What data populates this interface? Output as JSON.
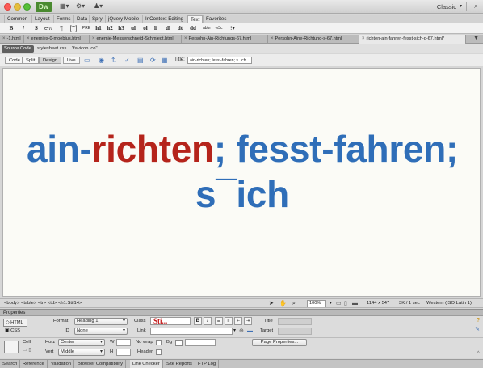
{
  "app": {
    "logo": "Dw",
    "workspace": "Classic"
  },
  "insert_tabs": [
    "Common",
    "Layout",
    "Forms",
    "Data",
    "Spry",
    "jQuery Mobile",
    "InContext Editing",
    "Text",
    "Favorites"
  ],
  "insert_active": "Text",
  "text_toolbar": [
    "B",
    "I",
    "S",
    "em",
    "¶",
    "[\"\"]",
    "PRE",
    "h1",
    "h2",
    "h3",
    "ul",
    "ol",
    "li",
    "dl",
    "dt",
    "dd",
    "abbr",
    "w3c",
    "⁝"
  ],
  "doc_tabs": [
    "-1.html",
    "enemies-0-moebius.html",
    "enemie-Messerschneid-Schmiedt.html",
    "Persohn-Ain-Richtungs-67.html",
    "Persohn-Aine-Richtung-s-67.html",
    "richten-ain-fahren-fesst-sich-d-67.html*"
  ],
  "related_files": {
    "source_code": "Source Code",
    "files": [
      "stylesheet.css",
      "\"favicon.ico\""
    ]
  },
  "doc_toolbar": {
    "views": [
      "Code",
      "Split",
      "Design",
      "Live"
    ],
    "active_view": "Design",
    "title_label": "Title:",
    "title_value": "ain-richten; fesst-fahren; s¯ich"
  },
  "canvas": {
    "heading_part1": "ain-",
    "heading_part2": "richten",
    "heading_part3": "; fesst-fahren;",
    "heading_line2": "s¯ich"
  },
  "statusbar": {
    "tag_selector": "<body> <table> <tr> <td> <h1.Stil14>",
    "zoom": "100%",
    "dimensions": "1144 x 547",
    "size_time": "3K / 1 sec",
    "encoding": "Western (ISO Latin 1)"
  },
  "properties": {
    "header": "Properties",
    "html_btn": "HTML",
    "css_btn": "CSS",
    "format_label": "Format",
    "format_value": "Heading 1",
    "class_label": "Class",
    "class_value": "Sti...",
    "bold": "B",
    "italic": "I",
    "title_label": "Title",
    "id_label": "ID",
    "id_value": "None",
    "link_label": "Link",
    "target_label": "Target",
    "cell_label": "Cell",
    "horz_label": "Horz",
    "horz_value": "Center",
    "w_label": "W",
    "nowrap_label": "No wrap",
    "bg_label": "Bg",
    "page_props": "Page Properties...",
    "vert_label": "Vert",
    "vert_value": "Middle",
    "h_label": "H",
    "header_label": "Header"
  },
  "bottom_tabs": [
    "Search",
    "Reference",
    "Validation",
    "Browser Compatibility",
    "Link Checker",
    "Site Reports",
    "FTP Log"
  ],
  "bottom_active": "Link Checker",
  "colors": {
    "heading_blue": "#2f6eb8",
    "heading_red": "#b5241b",
    "canvas_bg": "#fbfbf6"
  }
}
